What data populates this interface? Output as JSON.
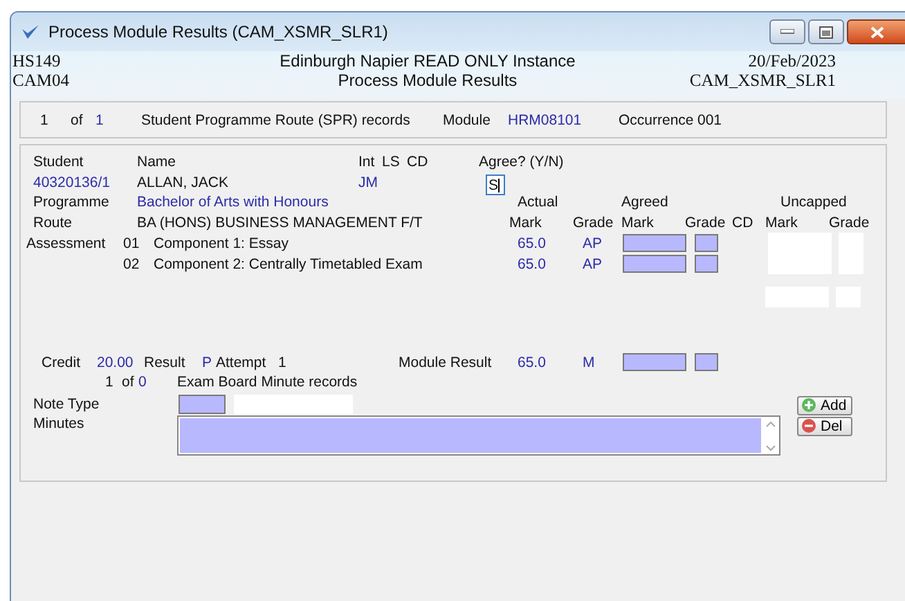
{
  "window": {
    "title": "Process Module Results (CAM_XSMR_SLR1)"
  },
  "header": {
    "left_top": "HS149",
    "left_bottom": "CAM04",
    "center_top": "Edinburgh Napier READ ONLY Instance",
    "center_bottom": "Process Module Results",
    "right_top": "20/Feb/2023",
    "right_bottom": "CAM_XSMR_SLR1"
  },
  "record_bar": {
    "current": "1",
    "of": "of",
    "total": "1",
    "label": "Student Programme Route (SPR) records",
    "module_label": "Module",
    "module": "HRM08101",
    "occurrence_label": "Occurrence",
    "occurrence": "001"
  },
  "student": {
    "labels": [
      "Student",
      "Name",
      "Int",
      "LS",
      "CD",
      "Agree? (Y/N)"
    ],
    "id": "40320136/1",
    "name": "ALLAN, JACK",
    "int": "JM",
    "agree": "S",
    "programme_label": "Programme",
    "programme": "Bachelor of Arts with Honours",
    "route_label": "Route",
    "route": "BA (HONS) BUSINESS MANAGEMENT F/T"
  },
  "groups": [
    "Actual",
    "Agreed",
    "Uncapped"
  ],
  "columns": [
    "Mark",
    "Grade",
    "Mark",
    "Grade",
    "CD",
    "Mark",
    "Grade"
  ],
  "assessment_label": "Assessment",
  "assessments": [
    {
      "code": "01",
      "name": "Component 1: Essay",
      "mark": "65.0",
      "grade": "AP"
    },
    {
      "code": "02",
      "name": "Component 2: Centrally Timetabled Exam",
      "mark": "65.0",
      "grade": "AP"
    }
  ],
  "result": {
    "credit_label": "Credit",
    "credit": "20.00",
    "result_label": "Result",
    "result": "P",
    "attempt_label": "Attempt",
    "attempt": "1",
    "module_result_label": "Module Result",
    "mark": "65.0",
    "grade": "M"
  },
  "minutes_bar": {
    "current": "1",
    "of": "of",
    "total": "0",
    "label": "Exam Board Minute records"
  },
  "note_type_label": "Note Type",
  "minutes_label": "Minutes",
  "buttons": [
    {
      "label": "Add",
      "kind": "add"
    },
    {
      "label": "Del",
      "kind": "delete"
    }
  ]
}
